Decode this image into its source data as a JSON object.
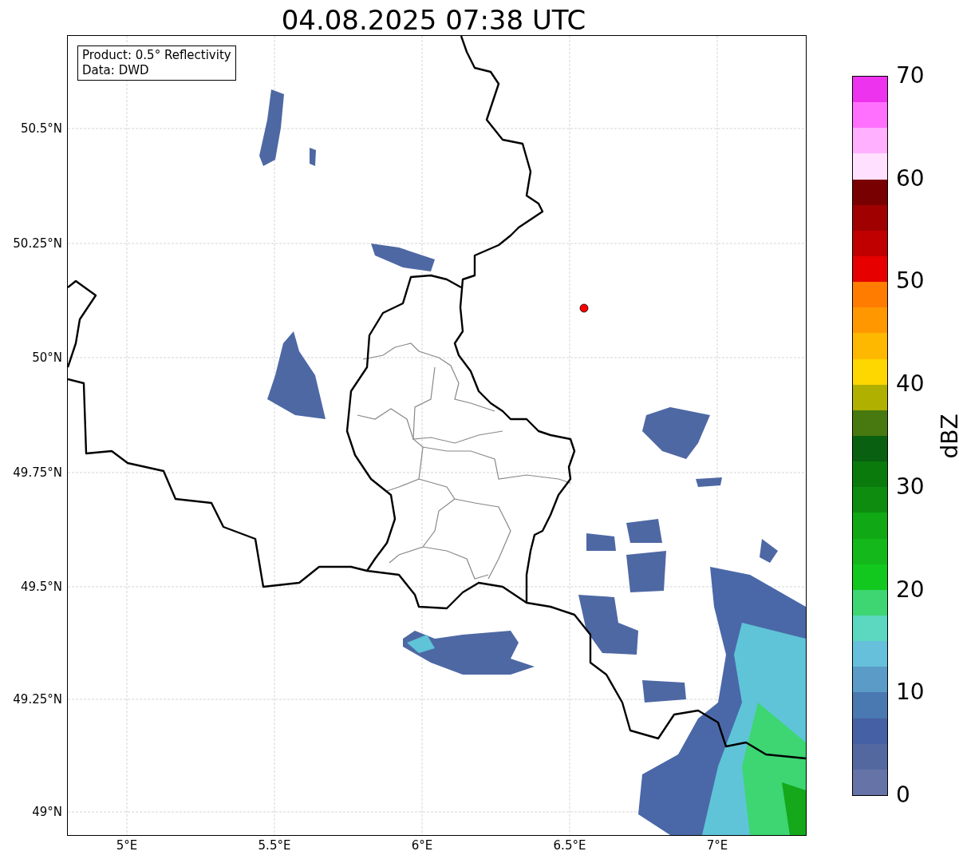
{
  "title": "04.08.2025 07:38 UTC",
  "legend": {
    "lines": [
      "Product: 0.5° Reflectivity",
      "Data: DWD"
    ]
  },
  "lat_ticks": [
    "50.5°N",
    "50.25°N",
    "50°N",
    "49.75°N",
    "49.5°N",
    "49.25°N",
    "49°N"
  ],
  "lon_ticks": [
    "5°E",
    "5.5°E",
    "6°E",
    "6.5°E",
    "7°E"
  ],
  "colorbar": {
    "label": "dBZ",
    "ticks": [
      "70",
      "60",
      "50",
      "40",
      "30",
      "20",
      "10",
      "0"
    ],
    "segments": [
      {
        "color": "#ee33ee"
      },
      {
        "color": "#ff70ff"
      },
      {
        "color": "#ffb0ff"
      },
      {
        "color": "#ffe0ff"
      },
      {
        "color": "#780000"
      },
      {
        "color": "#a00000"
      },
      {
        "color": "#c00000"
      },
      {
        "color": "#e60000"
      },
      {
        "color": "#ff7c00"
      },
      {
        "color": "#ff9800"
      },
      {
        "color": "#ffb800"
      },
      {
        "color": "#ffd700"
      },
      {
        "color": "#b0b000"
      },
      {
        "color": "#487810"
      },
      {
        "color": "#086010"
      },
      {
        "color": "#0a7a0c"
      },
      {
        "color": "#0e8c10"
      },
      {
        "color": "#10a814"
      },
      {
        "color": "#14b81a"
      },
      {
        "color": "#12c81e"
      },
      {
        "color": "#3dd672"
      },
      {
        "color": "#5cd8c0"
      },
      {
        "color": "#66c0dc"
      },
      {
        "color": "#5b9bc8"
      },
      {
        "color": "#4a78b0"
      },
      {
        "color": "#4560a4"
      },
      {
        "color": "#5468a0"
      },
      {
        "color": "#6573a7"
      }
    ]
  }
}
